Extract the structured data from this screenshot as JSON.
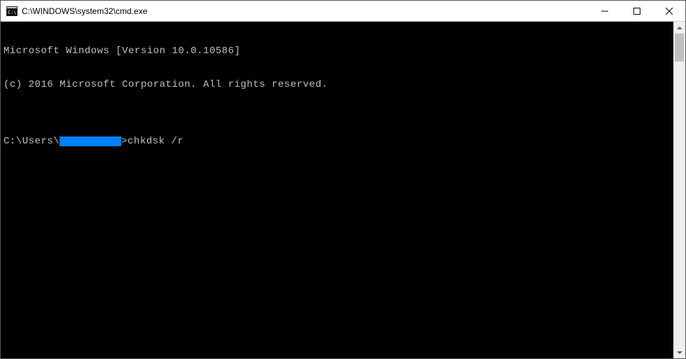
{
  "titlebar": {
    "title": "C:\\WINDOWS\\system32\\cmd.exe"
  },
  "terminal": {
    "line1": "Microsoft Windows [Version 10.0.10586]",
    "line2": "(c) 2016 Microsoft Corporation. All rights reserved.",
    "blank": "",
    "prompt_prefix": "C:\\Users\\",
    "prompt_suffix": ">",
    "command": "chkdsk /r"
  }
}
